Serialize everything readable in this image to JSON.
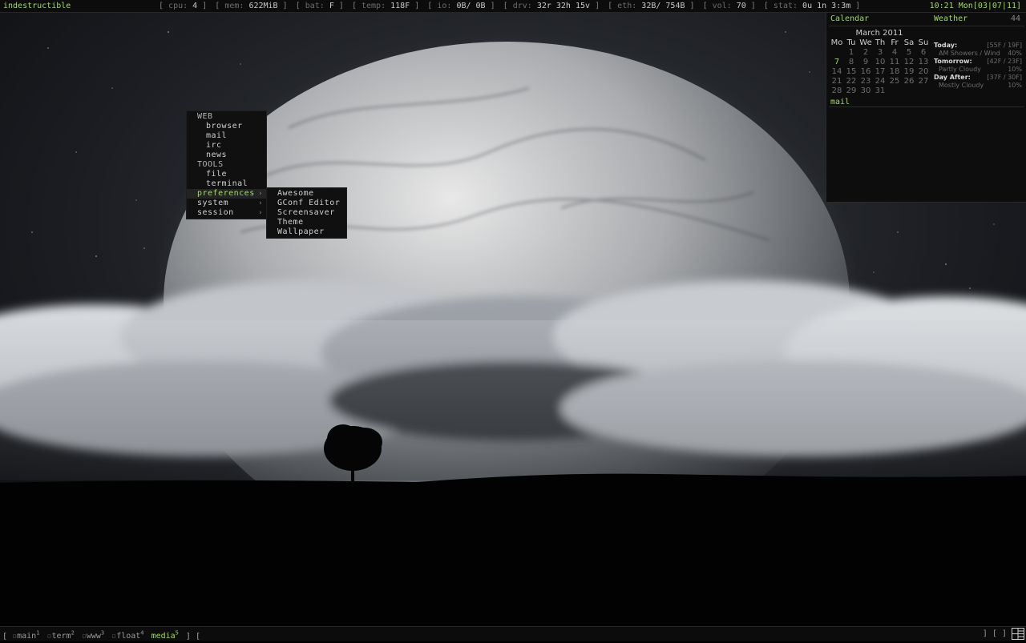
{
  "topbar": {
    "hostname": "indestructible",
    "status": [
      {
        "label": "cpu:",
        "value": "4"
      },
      {
        "label": "mem:",
        "value": "622MiB"
      },
      {
        "label": "bat:",
        "value": "F"
      },
      {
        "label": "temp:",
        "value": "118F"
      },
      {
        "label": "io:",
        "value": "0B/ 0B"
      },
      {
        "label": "drv:",
        "value": "32r 32h 15v"
      },
      {
        "label": "eth:",
        "value": "32B/ 754B"
      },
      {
        "label": "vol:",
        "value": "70"
      },
      {
        "label": "stat:",
        "value": "0u 1n 3:3m"
      }
    ],
    "clock": "10:21 Mon[03|07|11]"
  },
  "menu": {
    "items": [
      {
        "label": "WEB"
      },
      {
        "label": "browser"
      },
      {
        "label": "mail"
      },
      {
        "label": "irc"
      },
      {
        "label": "news"
      },
      {
        "label": "TOOLS"
      },
      {
        "label": "file"
      },
      {
        "label": "terminal"
      },
      {
        "label": "preferences",
        "arrow": "›"
      },
      {
        "label": "system",
        "arrow": "›"
      },
      {
        "label": "session",
        "arrow": "›"
      }
    ],
    "submenu": [
      "Awesome",
      "GConf Editor",
      "Screensaver",
      "Theme",
      "Wallpaper"
    ]
  },
  "panel": {
    "calendar_title": "Calendar",
    "weather_title": "Weather",
    "weather_temp": "44",
    "month": "March 2011",
    "weekdays": [
      "Mo",
      "Tu",
      "We",
      "Th",
      "Fr",
      "Sa",
      "Su"
    ],
    "today": "7",
    "days": [
      "",
      "1",
      "2",
      "3",
      "4",
      "5",
      "6",
      "7",
      "8",
      "9",
      "10",
      "11",
      "12",
      "13",
      "14",
      "15",
      "16",
      "17",
      "18",
      "19",
      "20",
      "21",
      "22",
      "23",
      "24",
      "25",
      "26",
      "27",
      "28",
      "29",
      "30",
      "31"
    ],
    "mail_label": "mail",
    "forecast": [
      {
        "day": "Today:",
        "range": "[55F / 19F]",
        "condition": "AM Showers / Wind",
        "chance": "40%"
      },
      {
        "day": "Tomorrow:",
        "range": "[42F / 23F]",
        "condition": "Partly Cloudy",
        "chance": "10%"
      },
      {
        "day": "Day After:",
        "range": "[37F / 30F]",
        "condition": "Mostly Cloudy",
        "chance": "10%"
      }
    ]
  },
  "bottombar": {
    "open_bracket": "[",
    "tags": [
      {
        "name": "main",
        "num": "1",
        "active": false
      },
      {
        "name": "term",
        "num": "2",
        "active": false
      },
      {
        "name": "www",
        "num": "3",
        "active": false
      },
      {
        "name": "float",
        "num": "4",
        "active": false
      },
      {
        "name": "media",
        "num": "5",
        "active": true
      }
    ],
    "close_brackets": "] [",
    "tray_brackets": "] [ ]"
  },
  "colors": {
    "accent": "#9fdc5a",
    "bar_bg": "#0c0c0c",
    "menu_bg": "#101010"
  }
}
